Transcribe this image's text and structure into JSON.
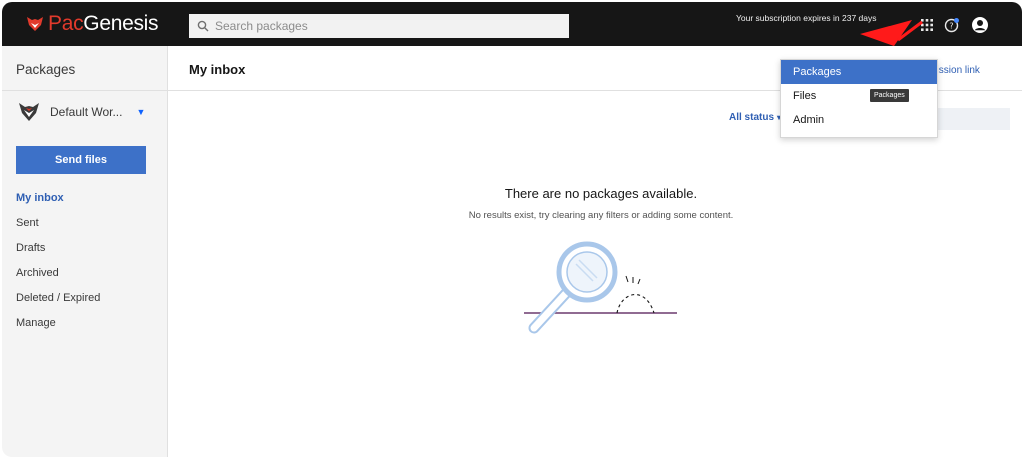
{
  "app": {
    "logo_prefix": "Pac",
    "logo_suffix": "Genesis"
  },
  "topbar": {
    "search_placeholder": "Search packages",
    "subscription_text": "Your subscription expires in 237 days"
  },
  "sidebar": {
    "title": "Packages",
    "workspace_name": "Default Wor...",
    "send_button": "Send files",
    "nav": [
      {
        "label": "My inbox",
        "active": true
      },
      {
        "label": "Sent"
      },
      {
        "label": "Drafts"
      },
      {
        "label": "Archived"
      },
      {
        "label": "Deleted / Expired"
      },
      {
        "label": "Manage"
      }
    ]
  },
  "main": {
    "title": "My inbox",
    "permission_link": "nission link",
    "status_filter": "All status",
    "empty_title": "There are no packages available.",
    "empty_subtitle": "No results exist, try clearing any filters or adding some content."
  },
  "app_switcher": {
    "items": [
      {
        "label": "Packages",
        "selected": true
      },
      {
        "label": "Files"
      },
      {
        "label": "Admin"
      }
    ],
    "tooltip": "Packages"
  },
  "colors": {
    "topbar": "#161616",
    "accent": "#3d71c8",
    "link": "#2f5fb3",
    "logo_red": "#e23a2c",
    "annotation_arrow": "#ff1a1a"
  },
  "icons": {
    "search": "search-icon",
    "apps": "grid-icon",
    "help": "help-icon",
    "user": "user-avatar-icon",
    "workspace": "fox-logo-icon"
  }
}
